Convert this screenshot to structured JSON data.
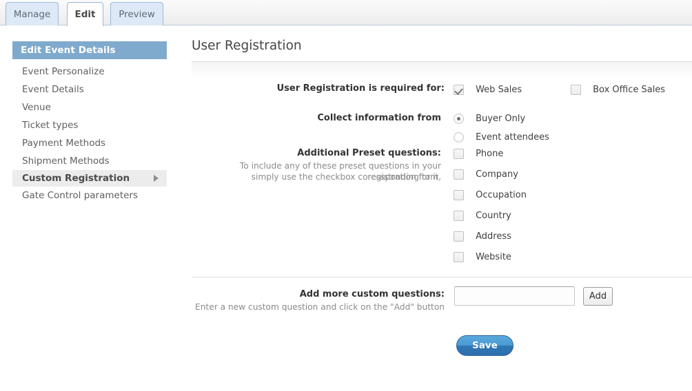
{
  "tabs": [
    {
      "label": "Manage",
      "active": false
    },
    {
      "label": "Edit",
      "active": true
    },
    {
      "label": "Preview",
      "active": false
    }
  ],
  "sidebar": {
    "header": "Edit Event Details",
    "items": [
      {
        "label": "Event Personalize"
      },
      {
        "label": "Event Details"
      },
      {
        "label": "Venue"
      },
      {
        "label": "Ticket types"
      },
      {
        "label": "Payment Methods"
      },
      {
        "label": "Shipment Methods"
      },
      {
        "label": "Custom Registration"
      },
      {
        "label": "Gate Control parameters"
      }
    ]
  },
  "main": {
    "title": "User Registration",
    "required_for": {
      "label": "User Registration is required for:",
      "options": [
        {
          "label": "Web Sales",
          "checked": true
        },
        {
          "label": "Box Office Sales",
          "checked": false
        }
      ]
    },
    "collect_from": {
      "label": "Collect information from",
      "options": [
        {
          "label": "Buyer Only",
          "selected": true
        },
        {
          "label": "Event attendees",
          "selected": false
        }
      ]
    },
    "preset_questions": {
      "label": "Additional Preset questions:",
      "help_line1": "To include any of these preset questions in your registration form,",
      "help_line2": "simply use the checkbox coressponding to it.",
      "options": [
        {
          "label": "Phone",
          "checked": false
        },
        {
          "label": "Company",
          "checked": false
        },
        {
          "label": "Occupation",
          "checked": false
        },
        {
          "label": "Country",
          "checked": false
        },
        {
          "label": "Address",
          "checked": false
        },
        {
          "label": "Website",
          "checked": false
        }
      ]
    },
    "custom_questions": {
      "label": "Add more custom questions:",
      "help": "Enter a new custom question and click on the \"Add\" button",
      "input_value": "",
      "input_placeholder": "",
      "add_button": "Add"
    },
    "save_button": "Save"
  },
  "colors": {
    "tab_active_bg": "#ffffff",
    "tab_inactive_bg": "#dde9f6",
    "tab_border": "#9cb9d6",
    "sidebar_header_bg": "#80aacd",
    "sidebar_selected_bg": "#ececec",
    "save_button_blue": "#3b85c4"
  }
}
